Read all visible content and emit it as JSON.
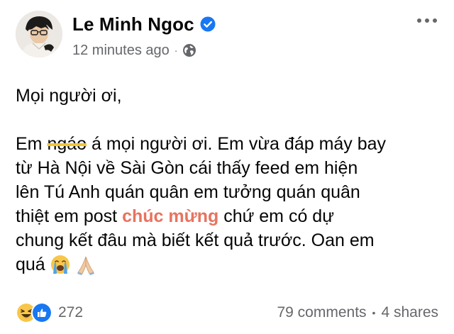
{
  "post": {
    "author": {
      "name": "Le Minh Ngoc",
      "verified": true
    },
    "timestamp": "12 minutes ago",
    "privacy_icon": "globe-icon",
    "separator": "·",
    "body": {
      "greeting": "Mọi người ơi,",
      "line1_start": "Em ",
      "line1_strike": "ngáo",
      "line1_end": " á mọi người ơi. Em vừa đáp máy bay",
      "line2": "từ Hà Nội về Sài Gòn cái thấy feed em hiện",
      "line3": "lên Tú Anh quán quân em tưởng quán quân",
      "line4_start": "thiệt em post ",
      "line4_highlight": "chúc mừng",
      "line4_end": " chứ em có dự",
      "line5": "chung kết đâu mà biết kết quả trước. Oan em",
      "line6": "quá",
      "emojis": [
        "crying-face-emoji",
        "folded-hands-emoji"
      ]
    },
    "reactions": {
      "icons": [
        "haha-reaction-icon",
        "like-reaction-icon"
      ],
      "count": "272"
    },
    "stats": {
      "comments": "79 comments",
      "separator": "•",
      "shares": "4 shares"
    }
  },
  "colors": {
    "text_primary": "#050505",
    "text_secondary": "#65676b",
    "verified_blue": "#1877f2",
    "highlight_orange": "#e8735f",
    "strike_yellow": "#f2c633",
    "like_blue": "#1877f2",
    "haha_yellow": "#f7c64a"
  }
}
